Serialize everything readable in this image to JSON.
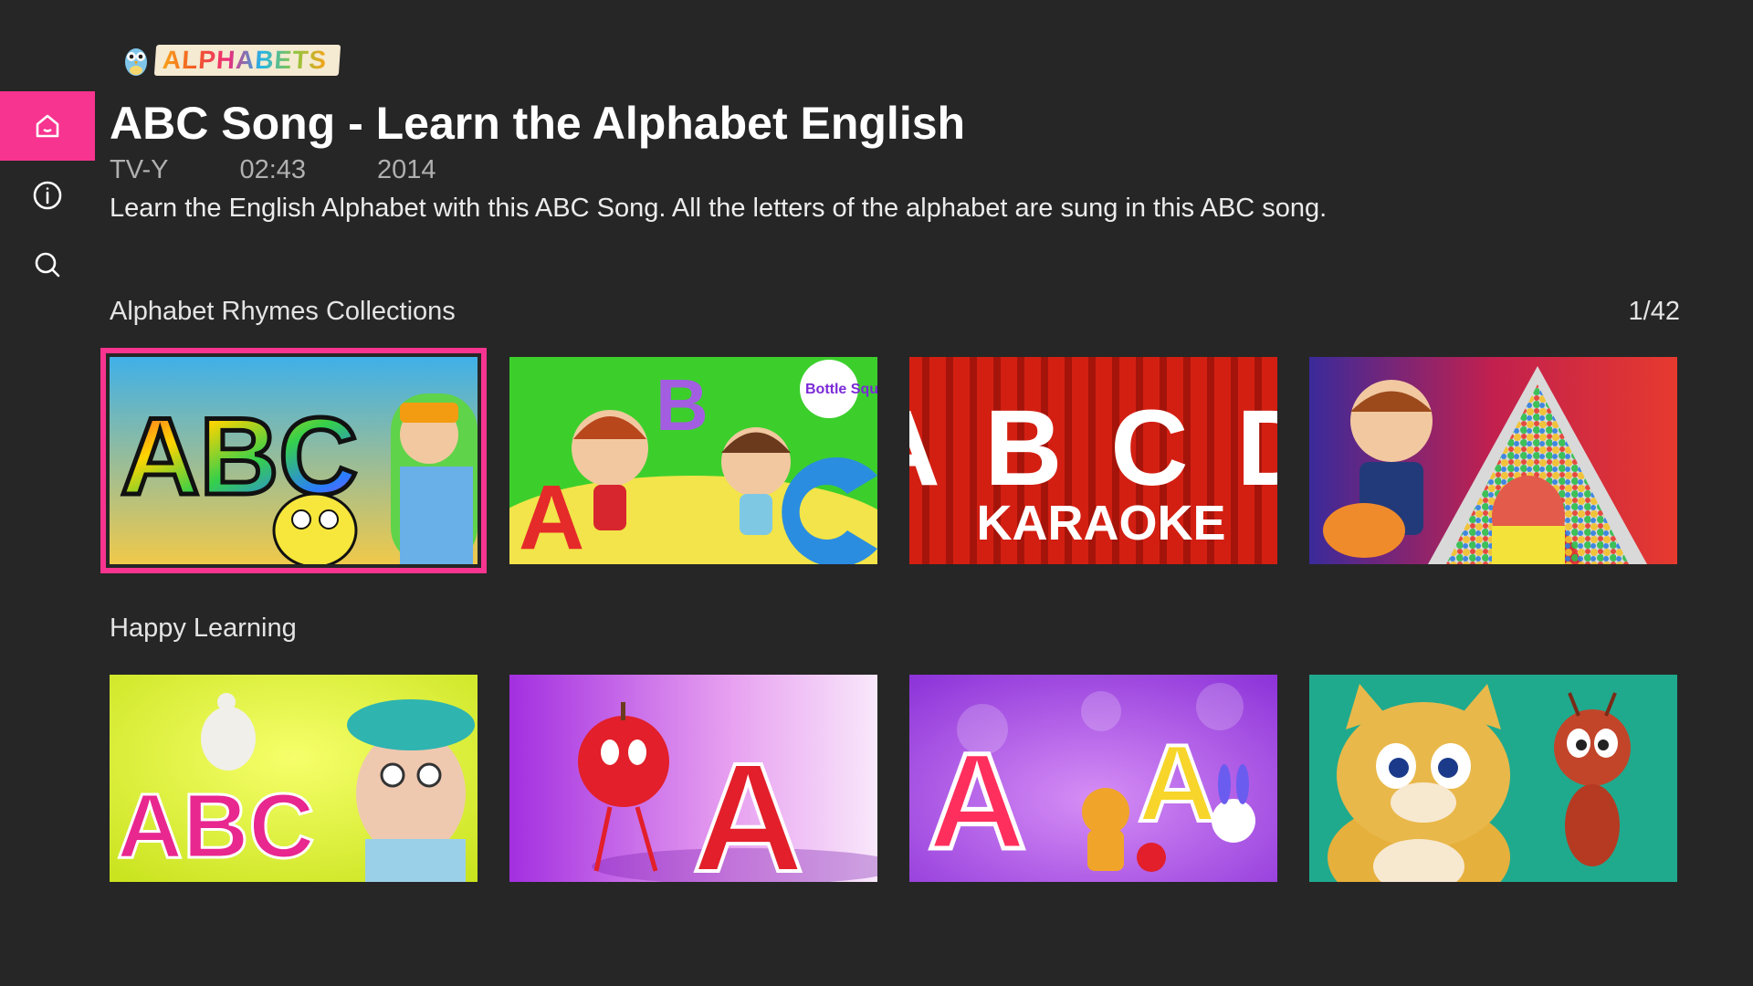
{
  "app": {
    "logo_text": "ALPHABETS"
  },
  "nav": {
    "items": [
      {
        "name": "home",
        "icon": "home-icon",
        "active": true
      },
      {
        "name": "info",
        "icon": "info-icon",
        "active": false
      },
      {
        "name": "search",
        "icon": "search-icon",
        "active": false
      }
    ]
  },
  "details": {
    "title": "ABC Song - Learn the Alphabet English",
    "rating": "TV-Y",
    "duration": "02:43",
    "year": "2014",
    "description": "Learn the English Alphabet with this ABC Song. All the letters of the alphabet are sung in this ABC song."
  },
  "rows": [
    {
      "title": "Alphabet Rhymes Collections",
      "counter": "1/42",
      "tiles": [
        {
          "text": "ABC",
          "focused": true
        },
        {
          "text": "A B",
          "badge": "Bottle Squad"
        },
        {
          "text": "A B C D",
          "subtext": "KARAOKE"
        },
        {
          "text": "A"
        }
      ]
    },
    {
      "title": "Happy Learning",
      "tiles": [
        {
          "text": "ABC"
        },
        {
          "text": "A"
        },
        {
          "text": "A A"
        },
        {
          "text": ""
        }
      ]
    }
  ],
  "colors": {
    "accent": "#f7348f",
    "background": "#262626"
  }
}
